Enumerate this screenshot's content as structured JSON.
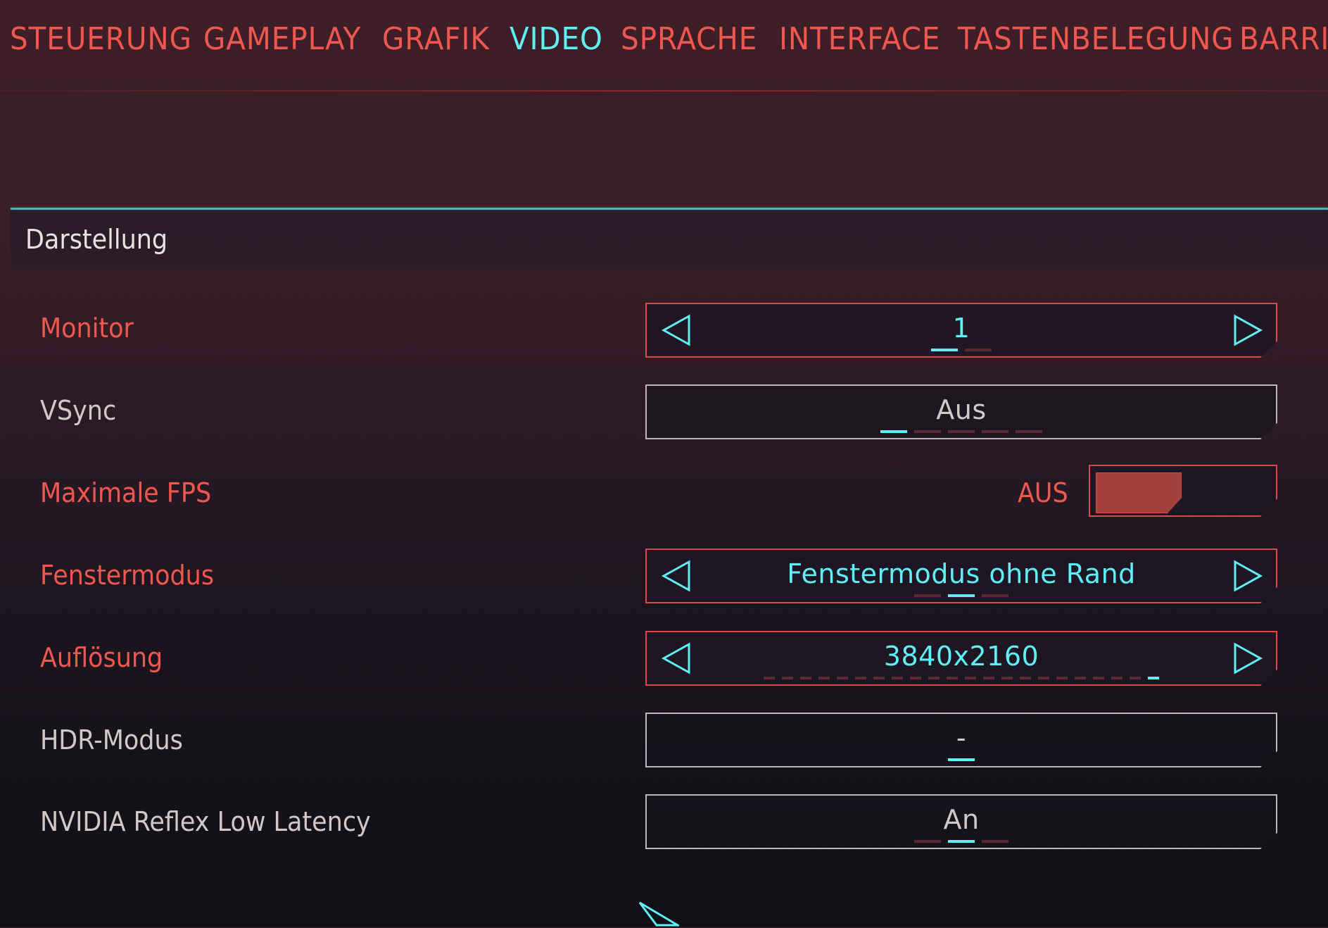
{
  "tabs": [
    {
      "label": "STEUERUNG"
    },
    {
      "label": "GAMEPLAY"
    },
    {
      "label": "GRAFIK"
    },
    {
      "label": "VIDEO",
      "active": true
    },
    {
      "label": "SPRACHE"
    },
    {
      "label": "INTERFACE"
    },
    {
      "label": "TASTENBELEGUNG"
    },
    {
      "label": "BARRI"
    }
  ],
  "section": {
    "title": "Darstellung"
  },
  "settings": {
    "monitor": {
      "label": "Monitor",
      "value": "1",
      "option_count": 2,
      "selected_index": 0
    },
    "vsync": {
      "label": "VSync",
      "value": "Aus",
      "option_count": 5,
      "selected_index": 0
    },
    "max_fps": {
      "label": "Maximale FPS",
      "value": "AUS",
      "enabled": false
    },
    "window_mode": {
      "label": "Fenstermodus",
      "value": "Fenstermodus ohne Rand",
      "option_count": 3,
      "selected_index": 1
    },
    "resolution": {
      "label": "Auflösung",
      "value": "3840x2160",
      "option_count": 22,
      "selected_index": 21
    },
    "hdr": {
      "label": "HDR-Modus",
      "value": "-",
      "option_count": 1,
      "selected_index": 0
    },
    "reflex": {
      "label": "NVIDIA Reflex Low Latency",
      "value": "An",
      "option_count": 3,
      "selected_index": 1
    }
  },
  "colors": {
    "accent_red": "#f0584f",
    "accent_cyan": "#5ff0f6",
    "divider_cyan": "#4fb3b5"
  },
  "icons": {
    "prev": "triangle-left-icon",
    "next": "triangle-right-icon",
    "cursor": "mouse-cursor-icon"
  }
}
